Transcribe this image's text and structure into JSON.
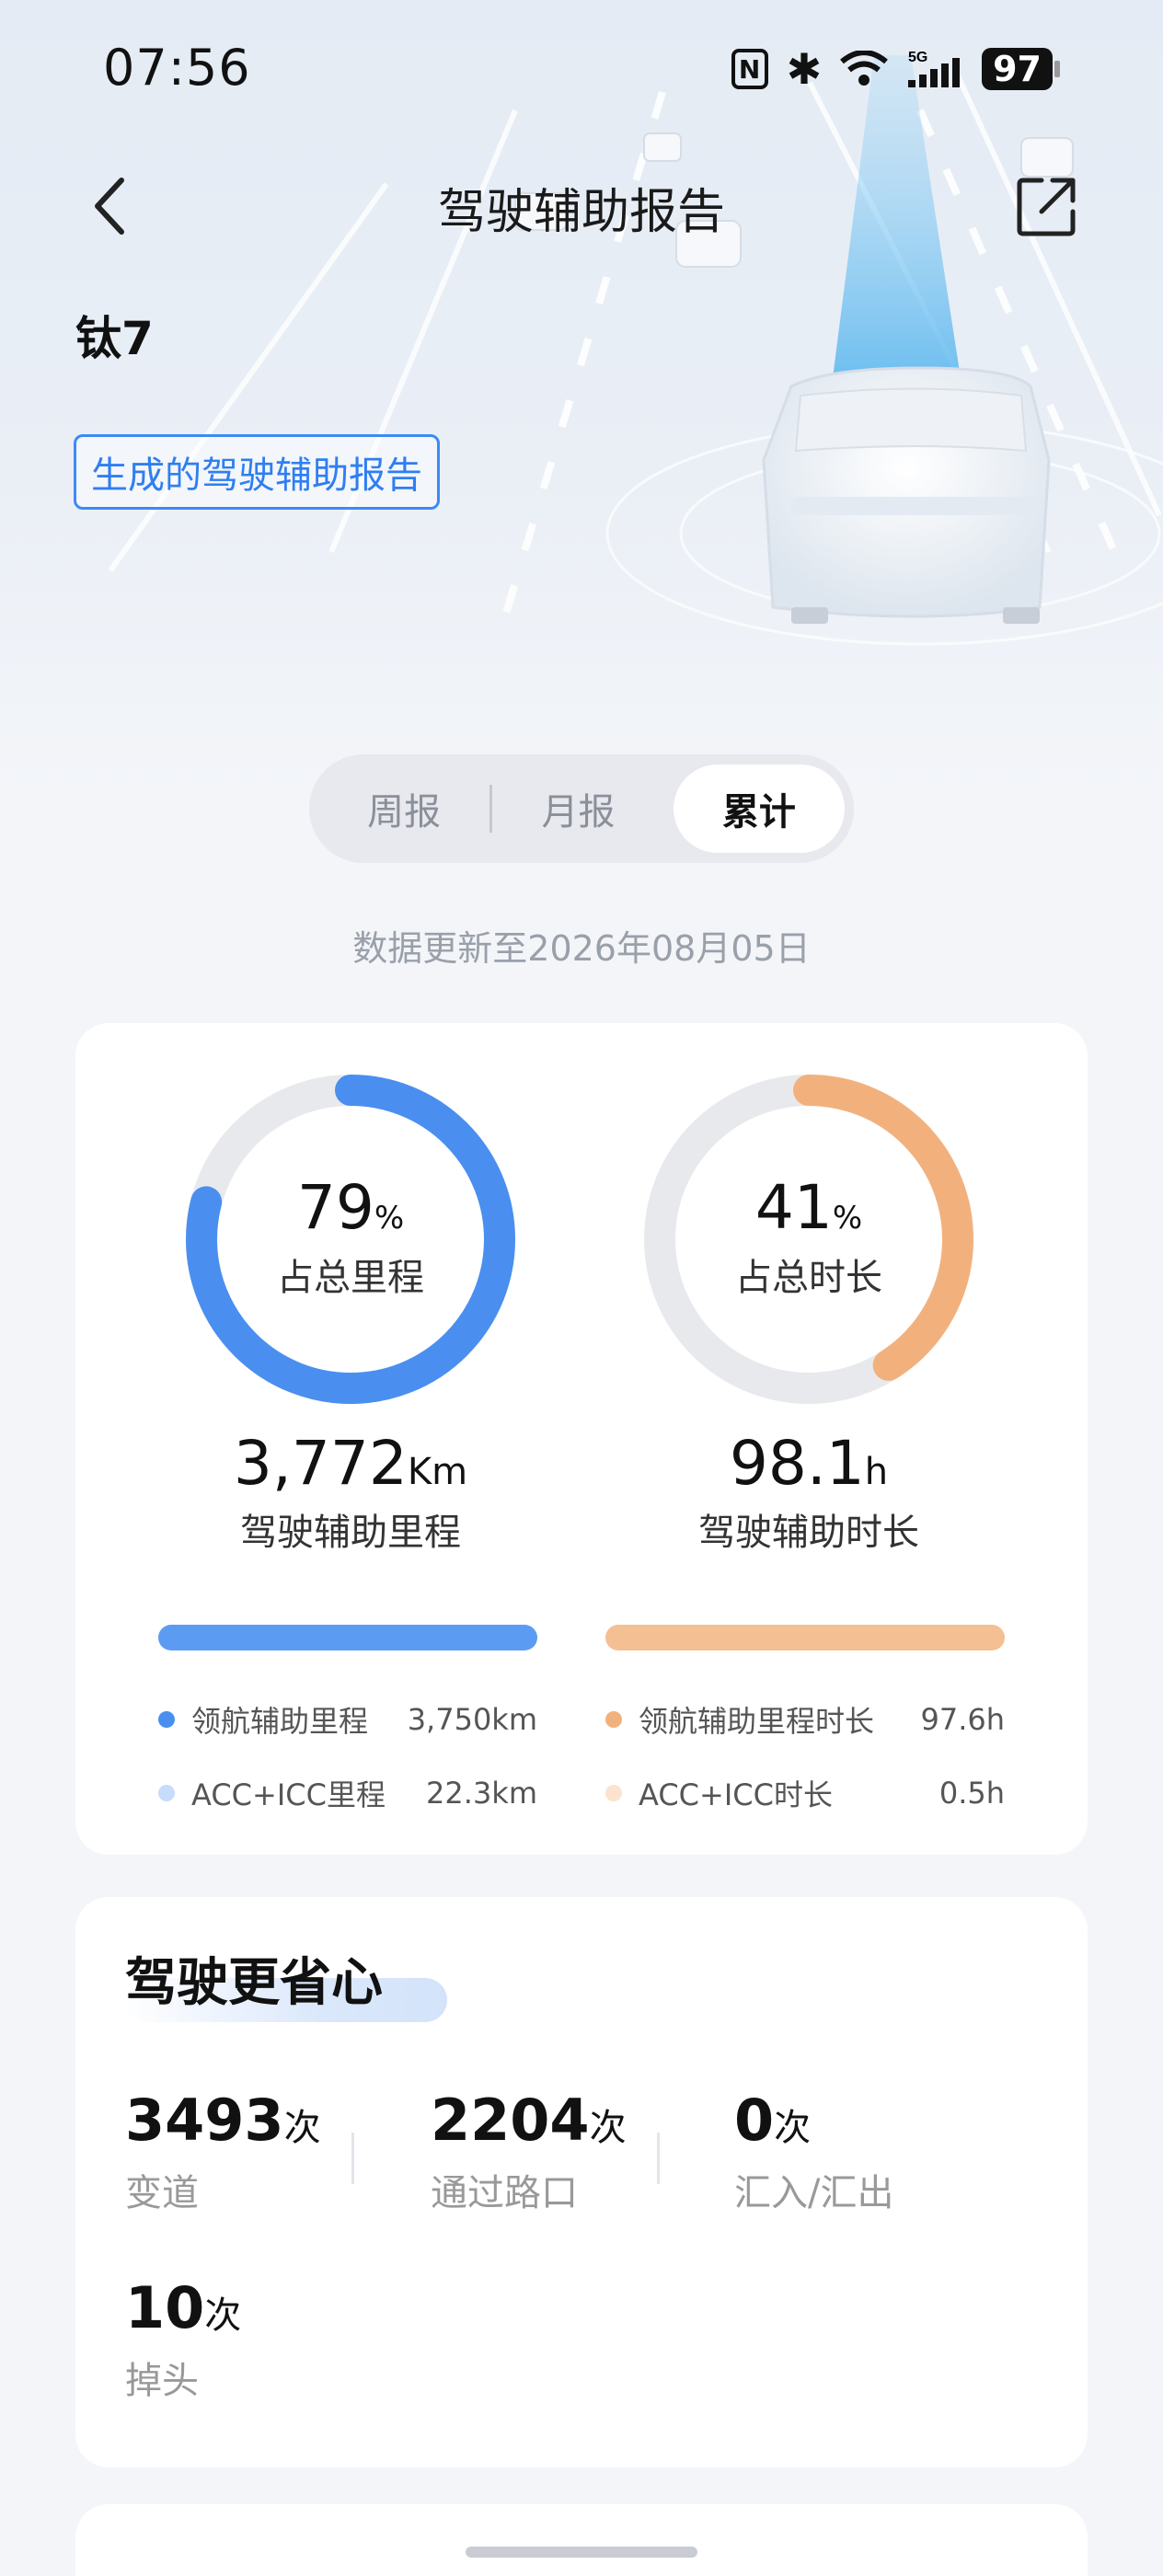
{
  "status_bar": {
    "time": "07:56",
    "battery": "97"
  },
  "header": {
    "title": "驾驶辅助报告"
  },
  "car": {
    "name": "钛7",
    "report_tag": "生成的驾驶辅助报告"
  },
  "tabs": [
    {
      "label": "周报",
      "active": false
    },
    {
      "label": "月报",
      "active": false
    },
    {
      "label": "累计",
      "active": true
    }
  ],
  "update_note": "数据更新至2026年08月05日",
  "summary": {
    "mileage": {
      "percent": "79",
      "percent_unit": "%",
      "percent_label": "占总里程",
      "value": "3,772",
      "unit": "Km",
      "label": "驾驶辅助里程",
      "ring_fraction": 0.79,
      "color": "#4a8ff0",
      "legend": [
        {
          "label": "领航辅助里程",
          "value": "3,750km",
          "color": "#4a8ff0"
        },
        {
          "label": "ACC+ICC里程",
          "value": "22.3km",
          "color": "#c7dcfa"
        }
      ]
    },
    "duration": {
      "percent": "41",
      "percent_unit": "%",
      "percent_label": "占总时长",
      "value": "98.1",
      "unit": "h",
      "label": "驾驶辅助时长",
      "ring_fraction": 0.41,
      "color": "#f2b17c",
      "legend": [
        {
          "label": "领航辅助里程时长",
          "value": "97.6h",
          "color": "#f2b17c"
        },
        {
          "label": "ACC+ICC时长",
          "value": "0.5h",
          "color": "#fbe3cf"
        }
      ]
    }
  },
  "ease_section": {
    "title": "驾驶更省心",
    "metrics": [
      {
        "value": "3493",
        "unit": "次",
        "label": "变道"
      },
      {
        "value": "2204",
        "unit": "次",
        "label": "通过路口"
      },
      {
        "value": "0",
        "unit": "次",
        "label": "汇入/汇出"
      },
      {
        "value": "10",
        "unit": "次",
        "label": "掉头"
      }
    ]
  }
}
